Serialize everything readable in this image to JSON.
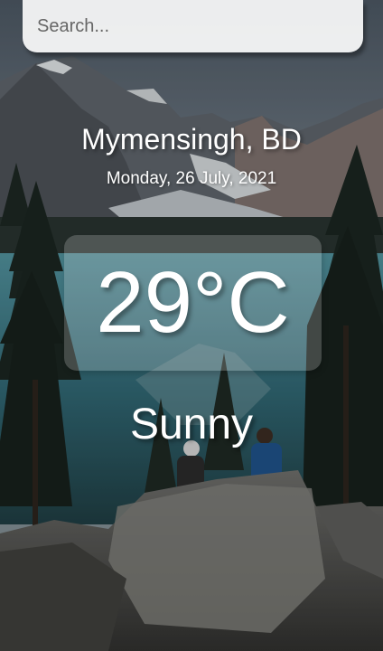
{
  "search": {
    "placeholder": "Search...",
    "value": ""
  },
  "location": {
    "name": "Mymensingh, BD",
    "date": "Monday, 26 July, 2021"
  },
  "weather": {
    "temperature": "29°C",
    "condition": "Sunny"
  },
  "background": {
    "description_icon": "mountain-lake-background"
  }
}
